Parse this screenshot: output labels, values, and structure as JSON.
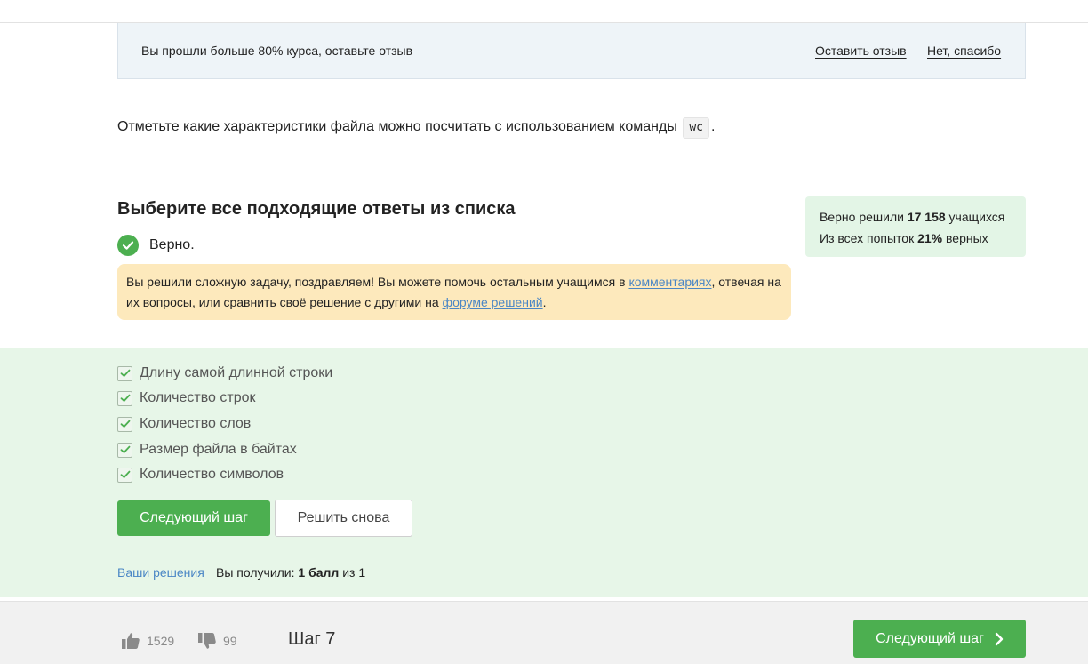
{
  "banner": {
    "text": "Вы прошли больше 80% курса, оставьте отзыв",
    "leave_review": "Оставить отзыв",
    "no_thanks": "Нет, спасибо"
  },
  "question": {
    "text_before": "Отметьте какие характеристики файла можно посчитать с использованием команды",
    "code": "wc",
    "text_after": "."
  },
  "quiz": {
    "title": "Выберите все подходящие ответы из списка",
    "verdict": "Верно.",
    "verdict_color": "#4caf50",
    "congrats": {
      "part1": "Вы решили сложную задачу, поздравляем! Вы можете помочь остальным учащимся в ",
      "link1": "комментариях",
      "part2": ", отвечая на их вопросы, или сравнить своё решение с другими на ",
      "link2": "форуме решений",
      "part3": "."
    }
  },
  "stats": {
    "solved_prefix": "Верно решили ",
    "solved_count": "17 158",
    "solved_suffix": " учащихся",
    "attempts_prefix": "Из всех попыток ",
    "attempts_percent": "21%",
    "attempts_suffix": " верных"
  },
  "options": [
    {
      "label": "Длину самой длинной строки",
      "checked": true
    },
    {
      "label": "Количество строк",
      "checked": true
    },
    {
      "label": "Количество слов",
      "checked": true
    },
    {
      "label": "Размер файла в байтах",
      "checked": true
    },
    {
      "label": "Количество символов",
      "checked": true
    }
  ],
  "actions": {
    "next_step": "Следующий шаг",
    "solve_again": "Решить снова"
  },
  "result": {
    "your_solutions": "Ваши решения",
    "received_prefix": "Вы получили: ",
    "points": "1 балл",
    "out_of": " из 1"
  },
  "footer": {
    "likes": "1529",
    "dislikes": "99",
    "step": "Шаг 7",
    "next_step": "Следующий шаг"
  },
  "colors": {
    "accent_green": "#4caf50",
    "answers_bg": "#e7f6e8",
    "link_blue": "#4a86c5",
    "congrats_bg": "#fde9bc"
  }
}
